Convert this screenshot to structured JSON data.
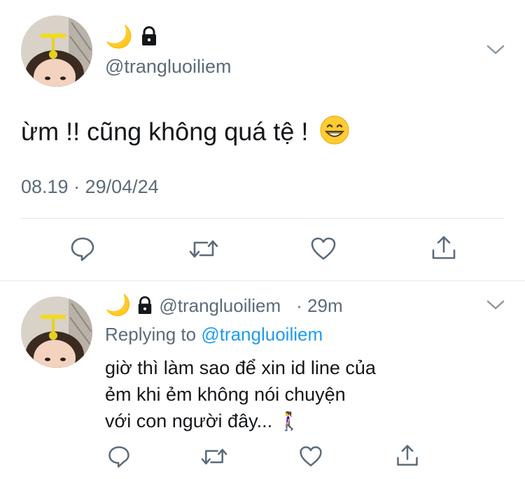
{
  "main_tweet": {
    "display_name_emoji": "🌙",
    "handle": "@trangluoiliem",
    "text": "ừm !! cũng không quá tệ !",
    "timestamp": "08.19 · 29/04/24",
    "icons": [
      "reply-icon",
      "retweet-icon",
      "like-icon",
      "share-icon"
    ]
  },
  "reply_tweet": {
    "display_name_emoji": "🌙",
    "handle": "@trangluoiliem",
    "time": "· 29m",
    "replying_label": "Replying to",
    "replying_to": "@trangluoiliem",
    "text_lines": [
      "giờ thì làm sao để xin id line của",
      "ẻm khi ẻm không nói chuyện",
      "với con người đây..."
    ],
    "trailing_emoji": "🚶‍♀️"
  },
  "colors": {
    "text": "#14171a",
    "secondary": "#5b6b7a",
    "link": "#1d9bf0",
    "divider": "#e1e8ed"
  }
}
